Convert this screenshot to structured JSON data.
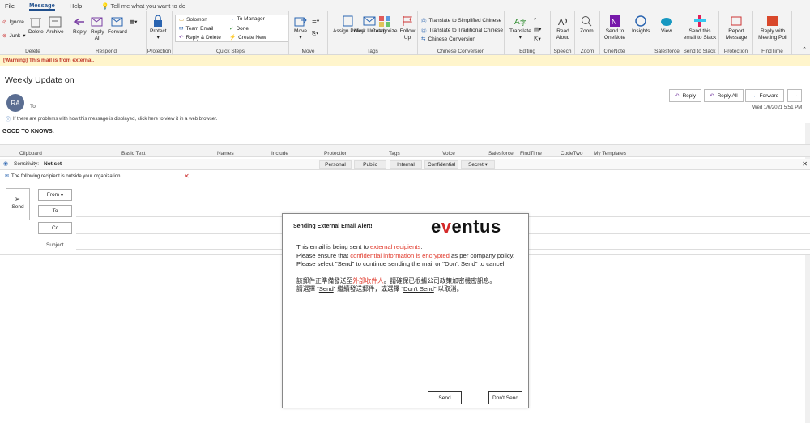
{
  "menubar": {
    "file": "File",
    "message": "Message",
    "help": "Help",
    "tell_me": "Tell me what you want to do"
  },
  "ribbon": {
    "delete_group": {
      "ignore": "Ignore",
      "junk": "Junk",
      "delete": "Delete",
      "archive": "Archive",
      "label": "Delete"
    },
    "respond_group": {
      "reply": "Reply",
      "reply_all": "Reply\nAll",
      "forward": "Forward",
      "label": "Respond"
    },
    "protection_group": {
      "protect": "Protect",
      "label": "Protection"
    },
    "quicksteps_group": {
      "items": [
        "Solomon",
        "Team Email",
        "Reply & Delete",
        "To Manager",
        "Done",
        "Create New"
      ],
      "label": "Quick Steps"
    },
    "move_group": {
      "move": "Move",
      "label": "Move"
    },
    "tags_group": {
      "assign_policy": "Assign Policy",
      "mark_unread": "Mark Unread",
      "categorize": "Categorize",
      "follow_up": "Follow Up",
      "label": "Tags"
    },
    "chinese_group": {
      "items": [
        "Translate to Simplified Chinese",
        "Translate to Traditional Chinese",
        "Chinese Conversion"
      ],
      "label": "Chinese Conversion"
    },
    "editing_group": {
      "translate": "Translate",
      "label": "Editing"
    },
    "speech_group": {
      "read_aloud": "Read Aloud",
      "label": "Speech"
    },
    "zoom_group": {
      "zoom": "Zoom",
      "label": "Zoom"
    },
    "onenote_group": {
      "send": "Send to OneNote",
      "label": "OneNote"
    },
    "insights": "Insights",
    "salesforce_group": {
      "view": "View",
      "label": "Salesforce"
    },
    "slack_group": {
      "send": "Send this email to Slack",
      "label": "Send to Slack"
    },
    "protection2_group": {
      "report": "Report Message",
      "label": "Protection"
    },
    "findtime_group": {
      "reply": "Reply with Meeting Poll",
      "label": "FindTime"
    }
  },
  "warning": "[Warning] This mail is from external.",
  "mail": {
    "subject": "Weekly Update on",
    "avatar": "RA",
    "to_label": "To",
    "info": "If there are problems with how this message is displayed, click here to view it in a web browser.",
    "body": "GOOD TO KNOWS.",
    "date": "Wed 1/6/2021 5:51 PM",
    "reply": "Reply",
    "reply_all": "Reply All",
    "forward": "Forward",
    "more": "···"
  },
  "ribbon2": {
    "labels": [
      "Clipboard",
      "Basic Text",
      "Names",
      "Include",
      "Protection",
      "Tags",
      "Voice",
      "Salesforce",
      "FindTime",
      "CodeTwo",
      "My Templates"
    ]
  },
  "sensitivity": {
    "label": "Sensitivity:",
    "value": "Not set",
    "options": [
      "Personal",
      "Public",
      "Internal",
      "Confidential",
      "Secret"
    ]
  },
  "compose": {
    "recipient_notice": "The following recipient is outside your organization:",
    "send": "Send",
    "from": "From",
    "to": "To",
    "cc": "Cc",
    "subject": "Subject"
  },
  "dialog": {
    "title": "Sending External Email Alert!",
    "logo_pre": "e",
    "logo_v": "v",
    "logo_post": "entus",
    "en_line1_a": "This email is being sent to ",
    "en_line1_b": "external recipients",
    ".": ".",
    "en_line2_a": "Please ensure that ",
    "en_line2_b": "confidential information is encrypted",
    "en_line2_c": " as per company policy.",
    "en_line3_a": "Please select \"",
    "en_send": "Send",
    "en_line3_b": "\" to continue sending the mail or \"",
    "en_dont": "Don't Send",
    "en_line3_c": "\" to cancel.",
    "zh_line1_a": "該郵件正準備發送至",
    "zh_line1_b": "外部收件人",
    "zh_line1_c": "。請確保已根據公司政策加密機密訊息。",
    "zh_line2_a": "請選擇 “",
    "zh_send": "Send",
    "zh_line2_b": "” 繼續發送郵件，或選擇 “",
    "zh_dont": "Don't Send",
    "zh_line2_c": "” 以取消。",
    "send_button": "Send",
    "dont_send_button": "Don't Send"
  }
}
